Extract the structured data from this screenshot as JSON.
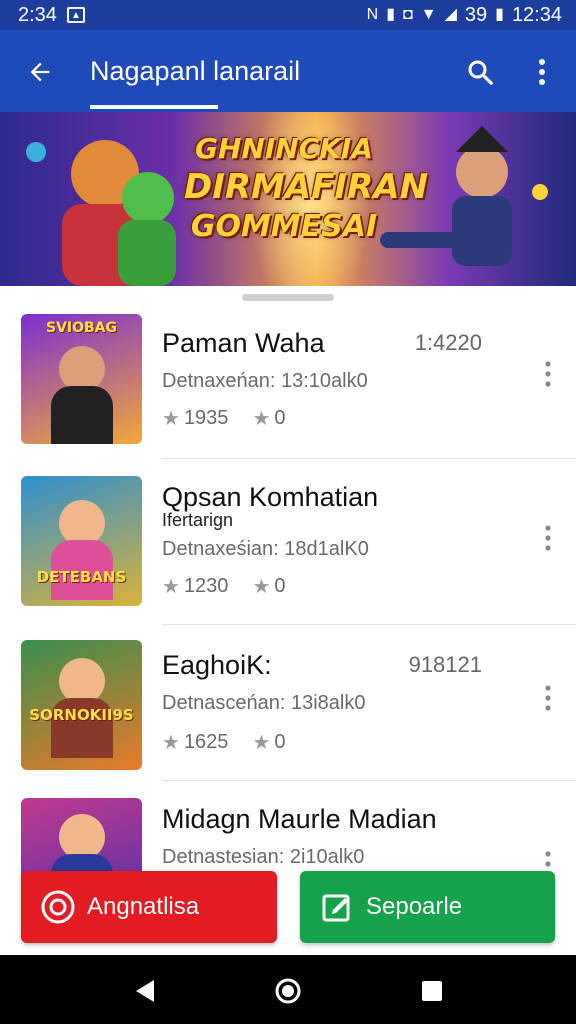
{
  "status_bar": {
    "left_time": "2:34",
    "battery_text": "39",
    "right_time": "12:34"
  },
  "app_bar": {
    "title": "Nagapanl lanarail"
  },
  "banner": {
    "lines": [
      "GHNINCKIA",
      "DIRMAFIRAN",
      "GOMMESAI"
    ]
  },
  "games": [
    {
      "title": "Paman Waha",
      "code": "1:4220",
      "meta": "Detnaxeńan: 13:10alk0",
      "rating": "1935",
      "count": "0",
      "thumb_label": "SVIOBAG",
      "thumb_colors": [
        "#7b2fd0",
        "#f2a93b"
      ]
    },
    {
      "title": "Qpsan Komhatian",
      "subtitle": "Ifertarign",
      "meta": "Detnaxeśian: 18d1alK0",
      "rating": "1230",
      "count": "0",
      "thumb_label": "DETEBANS",
      "thumb_colors": [
        "#2f8fd0",
        "#d9b33a"
      ]
    },
    {
      "title": "EaghoiK:",
      "code": "918121",
      "meta": "Detnasceńan: 13i8alk0",
      "rating": "1625",
      "count": "0",
      "thumb_label": "SORNOKII9S",
      "thumb_colors": [
        "#3a8f4f",
        "#e87a2a"
      ]
    },
    {
      "title": "Midagn Maurle Madian",
      "meta": "Detnastesian: 2i10alk0",
      "rating": "",
      "count": "",
      "thumb_label": "",
      "thumb_colors": [
        "#c23a8f",
        "#4a2fa8"
      ]
    }
  ],
  "actions": {
    "primary_label": "Angnatlisa",
    "secondary_label": "Sepoarle"
  },
  "colors": {
    "app_bar": "#1f4bb8",
    "status_bar": "#1c3f9f",
    "red": "#e31b23",
    "green": "#15a24a"
  }
}
